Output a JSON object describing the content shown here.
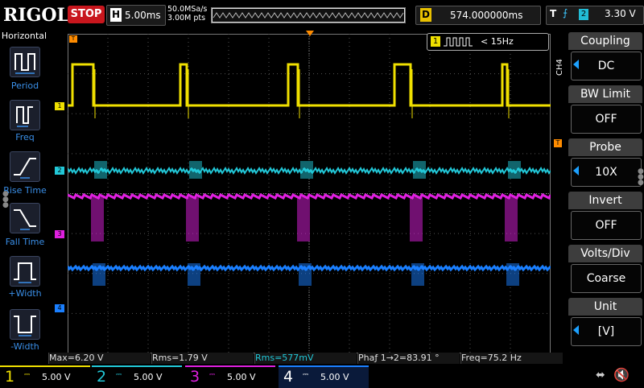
{
  "header": {
    "brand": "RIGOL",
    "run_state": "STOP",
    "horizontal_label": "H",
    "timebase": "5.00ms",
    "sample_rate": "50.0MSa/s",
    "memory_depth": "3.00M pts",
    "delay_label": "D",
    "delay": "574.000000ms",
    "trigger_label": "T",
    "trigger_source": "2",
    "trigger_level": "3.30 V"
  },
  "left_menu": {
    "title": "Horizontal",
    "items": [
      {
        "label": "Period",
        "icon": "period-icon"
      },
      {
        "label": "Freq",
        "icon": "freq-icon"
      },
      {
        "label": "Rise Time",
        "icon": "rise-time-icon"
      },
      {
        "label": "Fall Time",
        "icon": "fall-time-icon"
      },
      {
        "label": "+Width",
        "icon": "positive-width-icon"
      },
      {
        "label": "-Width",
        "icon": "negative-width-icon"
      }
    ]
  },
  "channel_info": {
    "channel_badge": "1",
    "frequency_text": "< 15Hz"
  },
  "right_menu": {
    "channel": "CH4",
    "items": [
      {
        "title": "Coupling",
        "value": "DC",
        "has_arrow": true
      },
      {
        "title": "BW Limit",
        "value": "OFF",
        "has_arrow": false
      },
      {
        "title": "Probe",
        "value": "10X",
        "has_arrow": true
      },
      {
        "title": "Invert",
        "value": "OFF",
        "has_arrow": false
      },
      {
        "title": "Volts/Div",
        "value": "Coarse",
        "has_arrow": false
      },
      {
        "title": "Unit",
        "value": "[V]",
        "has_arrow": true
      }
    ]
  },
  "measurements": [
    {
      "text": "Max=6.20 V",
      "color": "#e8e000"
    },
    {
      "text": "Rms=1.79 V",
      "color": "#e8e000"
    },
    {
      "text": "Rms=577mV",
      "color": "#22c8d8"
    },
    {
      "text": "Phaƒ 1→2=83.91 °",
      "color": "#e8e000"
    },
    {
      "text": "Freq=75.2 Hz",
      "color": "#e8e000"
    }
  ],
  "channels": [
    {
      "number": "1",
      "scale": "5.00 V",
      "color": "#f0e000"
    },
    {
      "number": "2",
      "scale": "5.00 V",
      "color": "#22c8d8"
    },
    {
      "number": "3",
      "scale": "5.00 V",
      "color": "#e020e0"
    },
    {
      "number": "4",
      "scale": "5.00 V",
      "color": "#1a7fff"
    }
  ],
  "colors": {
    "ch1": "#f0e000",
    "ch2": "#22c8d8",
    "ch3": "#e020e0",
    "ch4": "#1a7fff",
    "trigger": "#ff8c00",
    "stop": "#c8161d"
  },
  "status_icons": [
    "usb-icon",
    "speaker-muted-icon"
  ]
}
